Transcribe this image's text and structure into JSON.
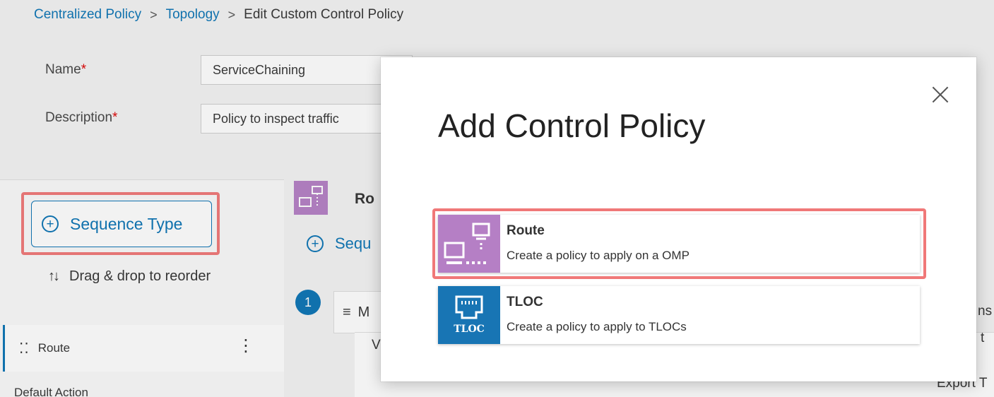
{
  "breadcrumb": {
    "items": [
      "Centralized Policy",
      "Topology",
      "Edit Custom Control Policy"
    ],
    "separator": ">"
  },
  "form": {
    "name_label": "Name",
    "name_value": "ServiceChaining",
    "description_label": "Description",
    "description_value": "Policy to inspect traffic",
    "required_mark": "*"
  },
  "sequence_panel": {
    "sequence_type_button": "Sequence Type",
    "drag_text": "Drag & drop to reorder",
    "item_label": "Route",
    "default_action": "Default Action"
  },
  "main_panel": {
    "route_heading": "Ro",
    "sequence_rule_button": "Sequ",
    "sequence_number": "1",
    "match_label": "M",
    "fragments": [
      "V",
      "V",
      "ns",
      "t",
      "Export T"
    ]
  },
  "modal": {
    "title": "Add Control Policy",
    "options": [
      {
        "title": "Route",
        "description": "Create a policy to apply on a OMP",
        "icon": "route-icon",
        "color": "#b57fc5"
      },
      {
        "title": "TLOC",
        "description": "Create a policy to apply to TLOCs",
        "icon": "tloc-icon",
        "icon_label": "TLOC",
        "color": "#1875b4"
      }
    ]
  },
  "colors": {
    "accent": "#0a74b5",
    "highlight": "#f07878",
    "required": "#dd0000"
  }
}
